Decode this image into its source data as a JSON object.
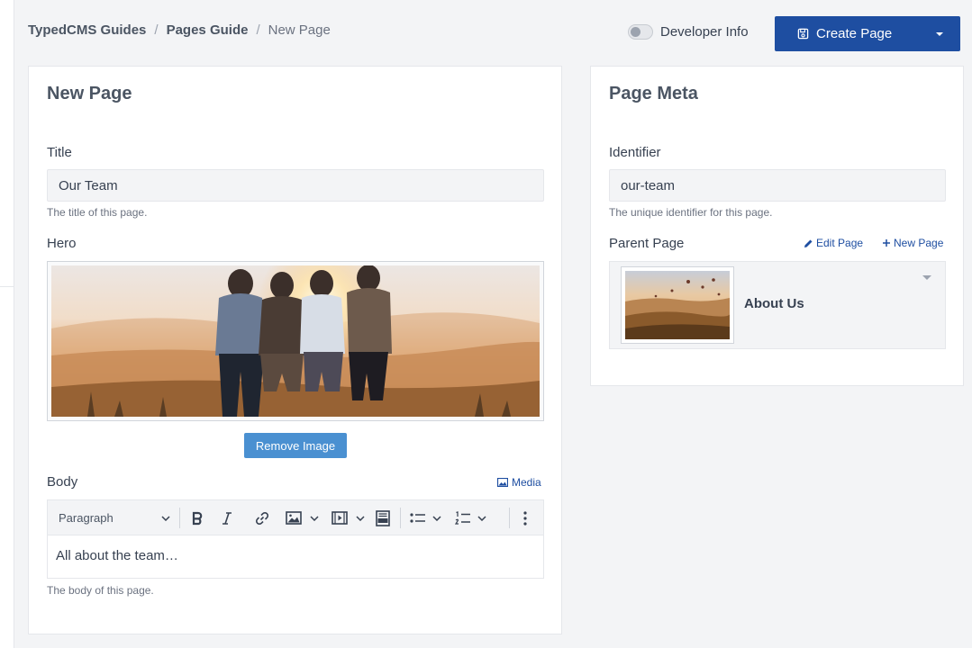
{
  "breadcrumb": [
    {
      "label": "TypedCMS Guides"
    },
    {
      "label": "Pages Guide"
    },
    {
      "label": "New Page"
    }
  ],
  "header": {
    "developer_toggle": {
      "label": "Developer Info",
      "enabled": false
    },
    "create_button": {
      "label": "Create Page",
      "color": "#1e4ea1",
      "icon": "save-icon"
    }
  },
  "left_card": {
    "title": "New Page",
    "title_field": {
      "label": "Title",
      "value": "Our Team",
      "help": "The title of this page."
    },
    "hero": {
      "label": "Hero",
      "image": "group-of-friends-at-sunset",
      "remove_label": "Remove Image"
    },
    "body": {
      "label": "Body",
      "media_label": "Media",
      "toolbar": {
        "block_format": "Paragraph",
        "buttons": [
          "bold-icon",
          "italic-icon",
          "link-icon",
          "image-icon",
          "video-icon",
          "html-icon",
          "bulleted-list-icon",
          "numbered-list-icon",
          "more-icon"
        ]
      },
      "content": "All about the team…",
      "help": "The body of this page."
    }
  },
  "right_card": {
    "title": "Page Meta",
    "identifier": {
      "label": "Identifier",
      "value": "our-team",
      "help": "The unique identifier for this page."
    },
    "parent": {
      "label": "Parent Page",
      "edit_label": "Edit Page",
      "new_label": "New Page",
      "selected": "About Us",
      "thumbnail": "hot-air-balloons-landscape"
    }
  },
  "colors": {
    "primary": "#1e4ea1",
    "secondary_button": "#4a90d1",
    "background": "#f3f4f6"
  }
}
